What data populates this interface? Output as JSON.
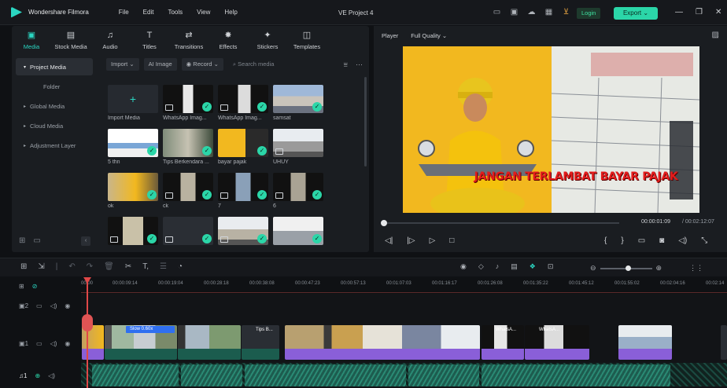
{
  "app": {
    "name": "Wondershare Filmora",
    "project_title": "VE Project 4",
    "menu": [
      "File",
      "Edit",
      "Tools",
      "View",
      "Help"
    ],
    "login_label": "Login",
    "export_label": "Export",
    "accent_color": "#2bd6c2"
  },
  "tabs": [
    {
      "label": "Media",
      "icon": "media-icon",
      "active": true
    },
    {
      "label": "Stock Media",
      "icon": "stock-media-icon"
    },
    {
      "label": "Audio",
      "icon": "music-note-icon"
    },
    {
      "label": "Titles",
      "icon": "text-t-icon"
    },
    {
      "label": "Transitions",
      "icon": "transitions-icon"
    },
    {
      "label": "Effects",
      "icon": "effects-sparkle-icon"
    },
    {
      "label": "Stickers",
      "icon": "sticker-icon"
    },
    {
      "label": "Templates",
      "icon": "templates-icon"
    }
  ],
  "sidebar": {
    "items": [
      {
        "label": "Project Media",
        "active": true
      },
      {
        "label": "Folder"
      },
      {
        "label": "Global Media"
      },
      {
        "label": "Cloud Media"
      },
      {
        "label": "Adjustment Layer"
      }
    ]
  },
  "media_toolbar": {
    "import_label": "Import",
    "ai_image_label": "AI Image",
    "record_label": "Record",
    "search_placeholder": "Search media"
  },
  "media_items": [
    {
      "label": "Import Media"
    },
    {
      "label": "WhatsApp Imag..."
    },
    {
      "label": "WhatsApp Imag..."
    },
    {
      "label": "samsat"
    },
    {
      "label": "5 thn"
    },
    {
      "label": "Tips Berkendara ..."
    },
    {
      "label": "bayar pajak"
    },
    {
      "label": "UHUY"
    },
    {
      "label": "ok"
    },
    {
      "label": "ck"
    },
    {
      "label": "7"
    },
    {
      "label": "6"
    },
    {
      "label": ""
    },
    {
      "label": ""
    },
    {
      "label": ""
    },
    {
      "label": ""
    }
  ],
  "player": {
    "label": "Player",
    "quality": "Full Quality",
    "overlay_text": "JANGAN TERLAMBAT BAYAR PAJAK",
    "current_time": "00:00:01:09",
    "total_time": "/ 00:02:12:07"
  },
  "timeline": {
    "ruler": [
      "00:00",
      "00:00:09:14",
      "00:00:19:04",
      "00:00:28:18",
      "00:00:38:08",
      "00:00:47:23",
      "00:00:57:13",
      "00:01:07:03",
      "00:01:16:17",
      "00:01:26:08",
      "00:01:35:22",
      "00:01:45:12",
      "00:01:55:02",
      "00:02:04:16",
      "00:02:14"
    ],
    "speed_tag": "Slow 0.60x",
    "clip_labels": [
      "Tips B...",
      "WhatsA...",
      "WhatsA..."
    ],
    "video_track_id": "1",
    "audio_track_id": "1",
    "overlay_track_id": "2"
  }
}
